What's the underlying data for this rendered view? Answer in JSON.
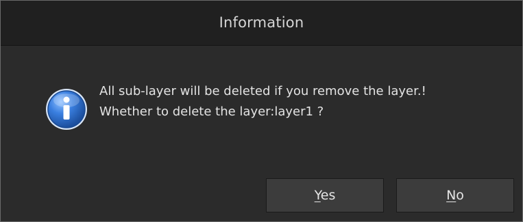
{
  "dialog": {
    "title": "Information",
    "icon": "info-icon",
    "message_lines": [
      "All sub-layer will be deleted if you remove the layer.!",
      "Whether to delete the layer:layer1 ?"
    ]
  },
  "buttons": {
    "yes": {
      "mnemonic": "Y",
      "rest": "es"
    },
    "no": {
      "mnemonic": "N",
      "rest": "o"
    }
  },
  "colors": {
    "background": "#2b2b2b",
    "titlebar": "#202020",
    "button": "#3c3c3c",
    "text": "#e3e3e3",
    "icon_blue": "#2f6fd1"
  }
}
